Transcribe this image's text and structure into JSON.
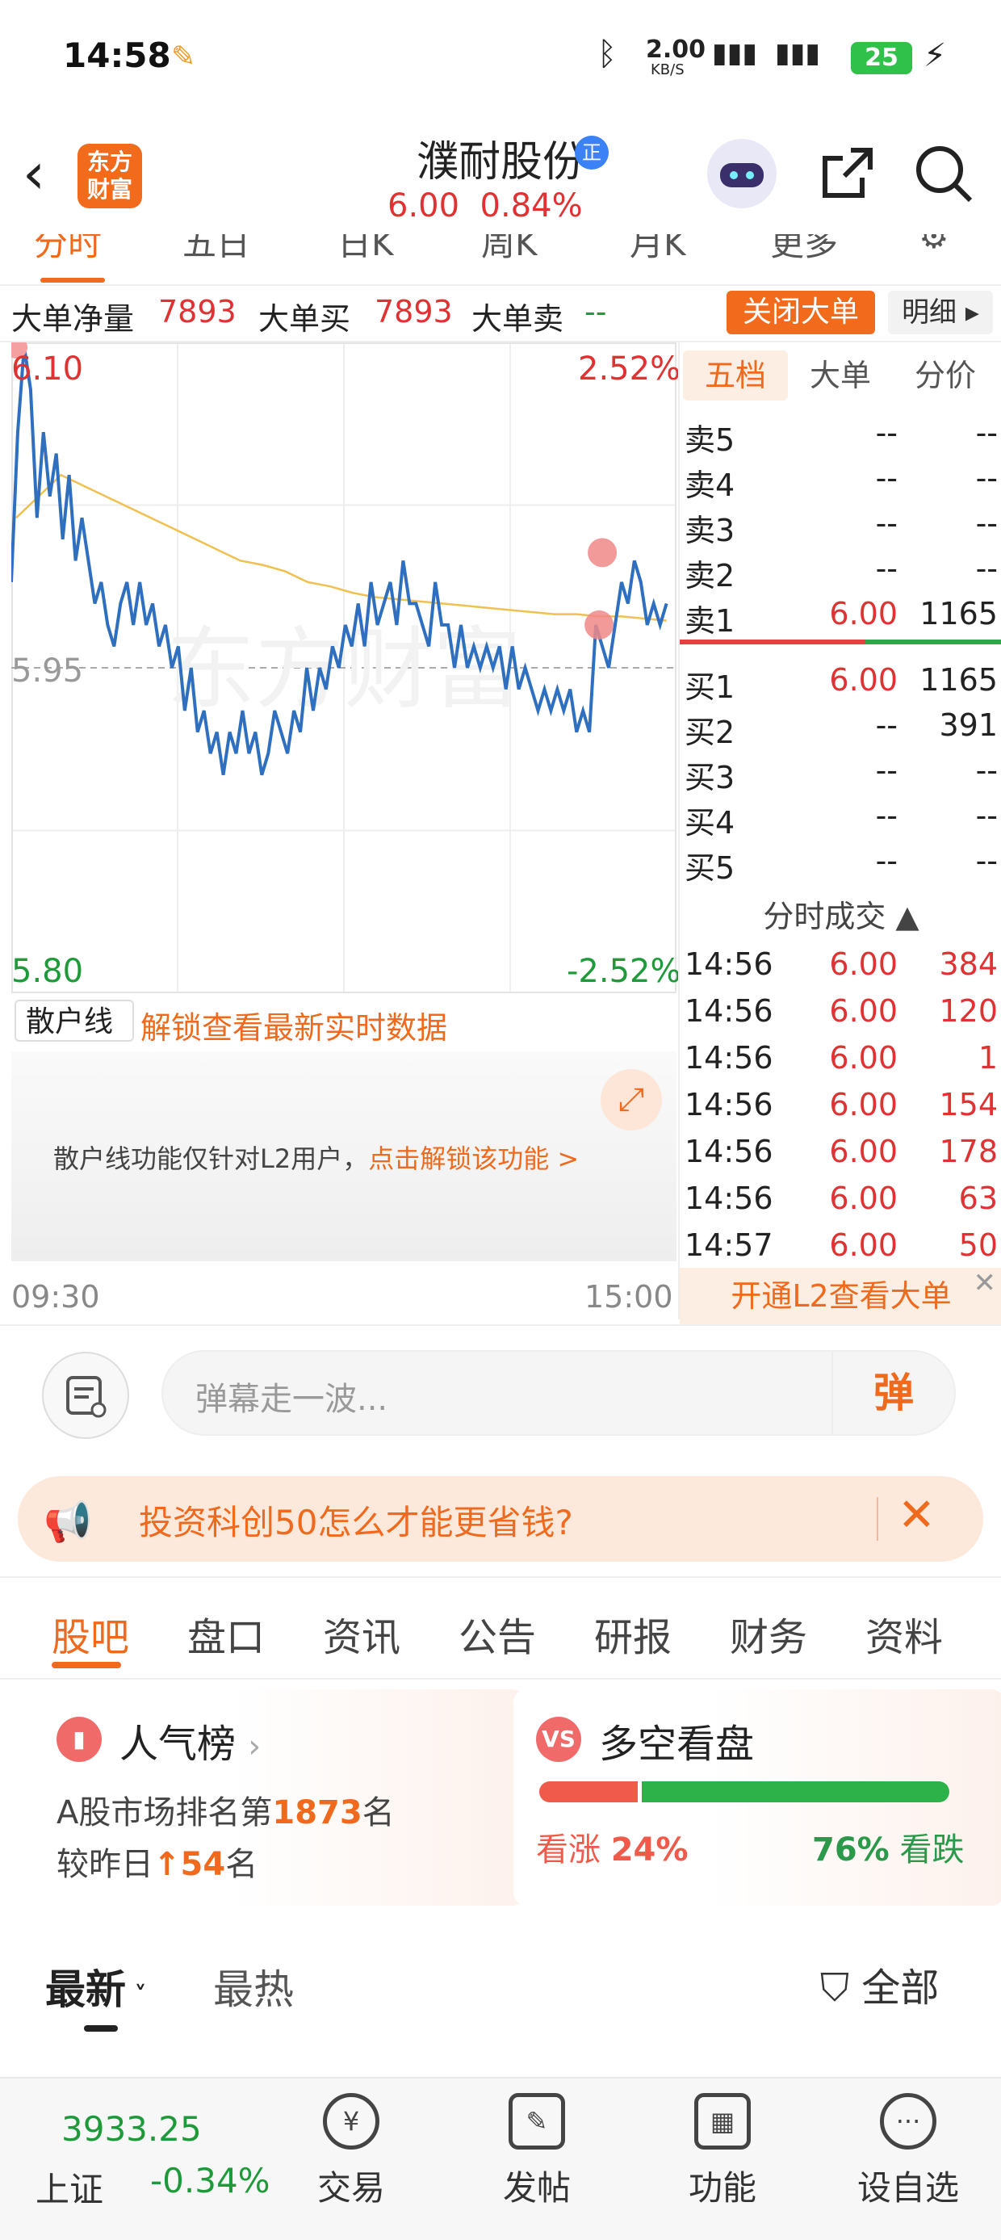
{
  "status_bar": {
    "time": "14:58",
    "net_speed": "2.00",
    "net_unit": "KB/S",
    "battery": "25"
  },
  "header": {
    "logo": [
      "东方",
      "财富"
    ],
    "stock_name": "濮耐股份",
    "badge": "正",
    "price": "6.00",
    "change_pct": "0.84%"
  },
  "chart_tabs": [
    "分时",
    "五日",
    "日K",
    "周K",
    "月K",
    "更多"
  ],
  "big_orders": {
    "net_label": "大单净量",
    "net_value": "7893",
    "buy_label": "大单买",
    "buy_value": "7893",
    "sell_label": "大单卖",
    "sell_value": "--",
    "close_button": "关闭大单",
    "detail_button": "明细 ▸"
  },
  "chart_data": {
    "type": "line",
    "x_start": "09:30",
    "x_end": "15:00",
    "ylim": [
      5.8,
      6.1
    ],
    "prev_close": 5.95,
    "labels": {
      "top_left": "6.10",
      "top_right": "2.52%",
      "mid_left": "5.95",
      "bottom_left": "5.80",
      "bottom_right": "-2.52%"
    },
    "series": [
      {
        "values": [
          5.99,
          6.06,
          6.1,
          6.08,
          6.02,
          6.06,
          6.03,
          6.05,
          6.01,
          6.04,
          6.0,
          6.02,
          6.0,
          5.98,
          5.99,
          5.97,
          5.96,
          5.98,
          5.99,
          5.97,
          5.99,
          5.97,
          5.98,
          5.96,
          5.97,
          5.95,
          5.96,
          5.93,
          5.95,
          5.92,
          5.93,
          5.91,
          5.92,
          5.9,
          5.92,
          5.91,
          5.93,
          5.91,
          5.92,
          5.9,
          5.91,
          5.93,
          5.92,
          5.91,
          5.93,
          5.92,
          5.95,
          5.93,
          5.95,
          5.94,
          5.96,
          5.95,
          5.97,
          5.96,
          5.98,
          5.96,
          5.99,
          5.97,
          5.98,
          5.99,
          5.97,
          6.0,
          5.98,
          5.98,
          5.97,
          5.96,
          5.99,
          5.97,
          5.97,
          5.95,
          5.97,
          5.95,
          5.96,
          5.95,
          5.96,
          5.95,
          5.96,
          5.94,
          5.96,
          5.94,
          5.95,
          5.94,
          5.93,
          5.94,
          5.93,
          5.94,
          5.93,
          5.94,
          5.92,
          5.93,
          5.92,
          5.97,
          5.96,
          5.95,
          5.97,
          5.99,
          5.98,
          6.0,
          5.99,
          5.97,
          5.98,
          5.97,
          5.98
        ]
      },
      {
        "values": [
          6.02,
          6.03,
          6.04,
          6.035,
          6.03,
          6.025,
          6.02,
          6.015,
          6.01,
          6.005,
          6.0,
          5.998,
          5.995,
          5.99,
          5.988,
          5.985,
          5.983,
          5.982,
          5.981,
          5.98,
          5.979,
          5.978,
          5.977,
          5.976,
          5.975,
          5.975,
          5.974,
          5.974,
          5.973,
          5.972
        ]
      }
    ]
  },
  "order_book": {
    "tabs": [
      "五档",
      "大单",
      "分价"
    ],
    "asks": [
      {
        "label": "卖5",
        "price": "--",
        "vol": "--"
      },
      {
        "label": "卖4",
        "price": "--",
        "vol": "--"
      },
      {
        "label": "卖3",
        "price": "--",
        "vol": "--"
      },
      {
        "label": "卖2",
        "price": "--",
        "vol": "--"
      },
      {
        "label": "卖1",
        "price": "6.00",
        "vol": "1165"
      }
    ],
    "bids": [
      {
        "label": "买1",
        "price": "6.00",
        "vol": "1165"
      },
      {
        "label": "买2",
        "price": "--",
        "vol": "391"
      },
      {
        "label": "买3",
        "price": "--",
        "vol": "--"
      },
      {
        "label": "买4",
        "price": "--",
        "vol": "--"
      },
      {
        "label": "买5",
        "price": "--",
        "vol": "--"
      }
    ],
    "trades_title": "分时成交 ▲",
    "trades": [
      {
        "time": "14:56",
        "price": "6.00",
        "vol": "384"
      },
      {
        "time": "14:56",
        "price": "6.00",
        "vol": "120"
      },
      {
        "time": "14:56",
        "price": "6.00",
        "vol": "1"
      },
      {
        "time": "14:56",
        "price": "6.00",
        "vol": "154"
      },
      {
        "time": "14:56",
        "price": "6.00",
        "vol": "178"
      },
      {
        "time": "14:56",
        "price": "6.00",
        "vol": "63"
      },
      {
        "time": "14:57",
        "price": "6.00",
        "vol": "50"
      }
    ],
    "l2_banner": "开通L2查看大单"
  },
  "retail": {
    "selector": "散户线 ▾",
    "unlock_text": "解锁查看最新实时数据",
    "message": "散户线功能仅针对L2用户，",
    "message_link": "点击解锁该功能 >"
  },
  "danmu": {
    "placeholder": "弹幕走一波...",
    "button": "弹"
  },
  "promo": {
    "text": "投资科创50怎么才能更省钱?"
  },
  "section_tabs": [
    "股吧",
    "盘口",
    "资讯",
    "公告",
    "研报",
    "财务",
    "资料"
  ],
  "popularity": {
    "title": "人气榜",
    "rank_prefix": "A股市场排名第",
    "rank": "1873",
    "rank_suffix": "名",
    "change_prefix": "较昨日",
    "change_arrow": "↑",
    "change": "54",
    "change_suffix": "名"
  },
  "sentiment": {
    "title": "多空看盘",
    "bull_label": "看涨",
    "bull_pct": "24%",
    "bull_value": 24,
    "bear_label": "看跌",
    "bear_pct": "76%",
    "bear_value": 76
  },
  "feed": {
    "latest": "最新",
    "hot": "最热",
    "all": "全部"
  },
  "bottom_nav": {
    "index_value": "3933.25",
    "index_name": "上证",
    "index_change": "-0.34%",
    "items": [
      "交易",
      "发帖",
      "功能",
      "设自选"
    ]
  }
}
